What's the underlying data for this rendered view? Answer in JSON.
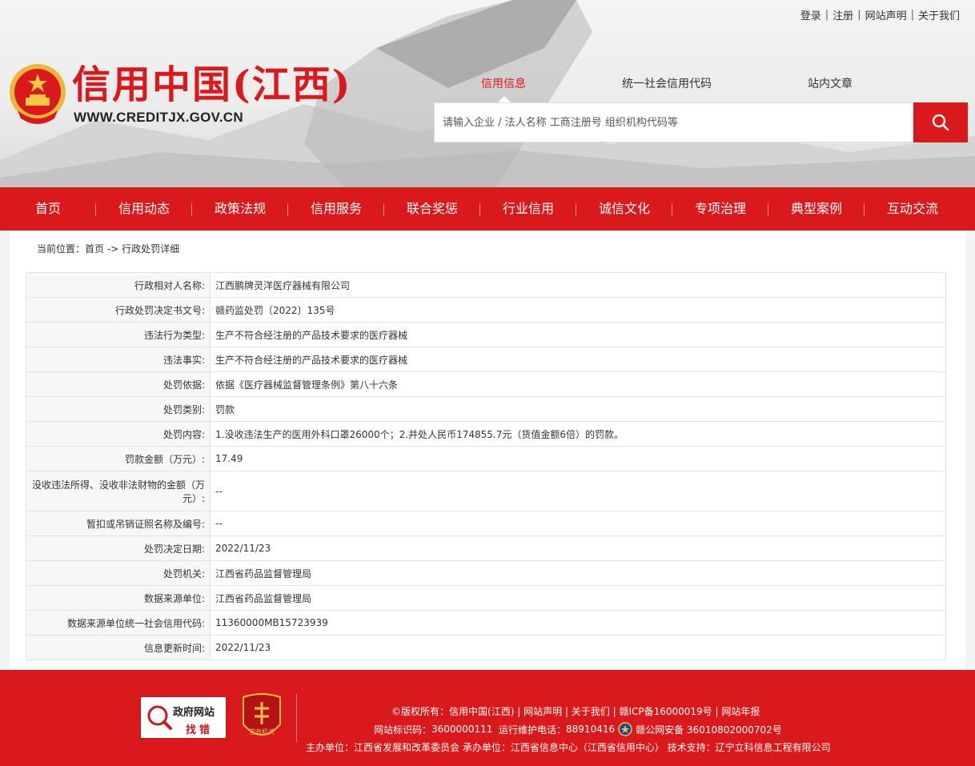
{
  "top_links": [
    "登录",
    "注册",
    "网站声明",
    "关于我们"
  ],
  "top_link_separator": "|",
  "logo": {
    "title": "信用中国(江西)",
    "url": "WWW.CREDITJX.GOV.CN",
    "emblem_icon": "national-emblem-icon"
  },
  "search": {
    "tabs": [
      "信用信息",
      "统一社会信用代码",
      "站内文章"
    ],
    "active_tab": "信用信息",
    "placeholder": "请输入企业 / 法人名称 工商注册号 组织机构代码等",
    "value": "",
    "button_icon": "search-icon"
  },
  "nav": [
    "首页",
    "信用动态",
    "政策法规",
    "信用服务",
    "联合奖惩",
    "行业信用",
    "诚信文化",
    "专项治理",
    "典型案例",
    "互动交流"
  ],
  "breadcrumb": {
    "prefix": "当前位置：",
    "home": "首页",
    "arrow": "->",
    "current": "行政处罚详细"
  },
  "details": [
    {
      "label": "行政相对人名称:",
      "value": "江西鹏牌灵洋医疗器械有限公司"
    },
    {
      "label": "行政处罚决定书文号:",
      "value": "赣药监处罚〔2022〕135号"
    },
    {
      "label": "违法行为类型:",
      "value": "生产不符合经注册的产品技术要求的医疗器械"
    },
    {
      "label": "违法事实:",
      "value": "生产不符合经注册的产品技术要求的医疗器械"
    },
    {
      "label": "处罚依据:",
      "value": "依据《医疗器械监督管理条例》第八十六条"
    },
    {
      "label": "处罚类别:",
      "value": "罚款"
    },
    {
      "label": "处罚内容:",
      "value": "1.没收违法生产的医用外科口罩26000个；2.并处人民币174855.7元（货值金额6倍）的罚款。"
    },
    {
      "label": "罚款金额（万元）:",
      "value": "17.49"
    },
    {
      "label": "没收违法所得、没收非法财物的金额（万元）:",
      "value": "--"
    },
    {
      "label": "暂扣或吊销证照名称及编号:",
      "value": "--"
    },
    {
      "label": "处罚决定日期:",
      "value": "2022/11/23"
    },
    {
      "label": "处罚机关:",
      "value": "江西省药品监督管理局"
    },
    {
      "label": "数据来源单位:",
      "value": "江西省药品监督管理局"
    },
    {
      "label": "数据来源单位统一社会信用代码:",
      "value": "11360000MB15723939"
    },
    {
      "label": "信息更新时间:",
      "value": "2022/11/23"
    }
  ],
  "footer": {
    "badge1_line1": "政府网站",
    "badge1_line2": "找错",
    "badge2_text": "党政机关",
    "line1_prefix": "©版权所有：",
    "line1_links": [
      "信用中国(江西)",
      "网站声明",
      "关于我们",
      "赣ICP备16000019号",
      "网站年报"
    ],
    "line2_id_label": "网站标识码：",
    "line2_id": "3600000111",
    "line2_phone_label": "运行维护电话：",
    "line2_phone": "88910416",
    "line2_police": "赣公网安备 36010802000702号",
    "line3": "主办单位：江西省发展和改革委员会   承办单位：江西省信息中心（江西省信用中心）   技术支持：辽宁立科信息工程有限公司"
  },
  "colors": {
    "brand_red": "#d9191c",
    "footer_red": "#d9191c",
    "label_bg": "#f7f7f7"
  }
}
